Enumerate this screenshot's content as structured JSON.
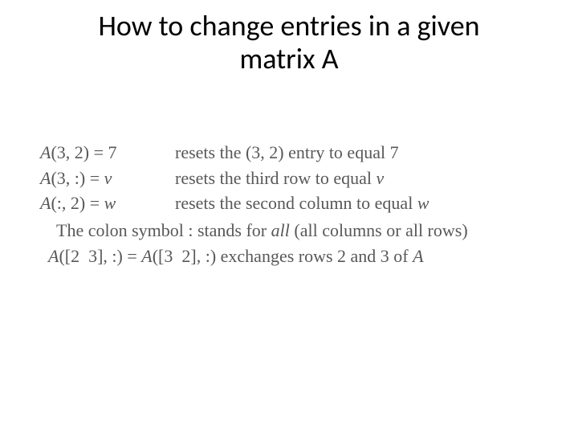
{
  "title_line1": "How to change entries in a given",
  "title_line2": "matrix A",
  "rows": [
    {
      "lhs_a": "A",
      "lhs_b": "(3, 2) = 7",
      "rhs": "resets the (3, 2) entry to equal 7"
    },
    {
      "lhs_a": "A",
      "lhs_b": "(3, :) = ",
      "lhs_c": "v",
      "rhs_a": "resets the third row to equal ",
      "rhs_b": "v"
    },
    {
      "lhs_a": "A",
      "lhs_b": "(:, 2) = ",
      "lhs_c": "w",
      "rhs_a": "resets the second column to equal ",
      "rhs_b": "w"
    }
  ],
  "note_a": "The colon symbol : stands for ",
  "note_b": "all",
  "note_c": " (all columns or all rows)",
  "exchange_a": "A",
  "exchange_b": "([2  3], :) = ",
  "exchange_c": "A",
  "exchange_d": "([3  2], :) exchanges rows 2 and 3 of ",
  "exchange_e": "A"
}
